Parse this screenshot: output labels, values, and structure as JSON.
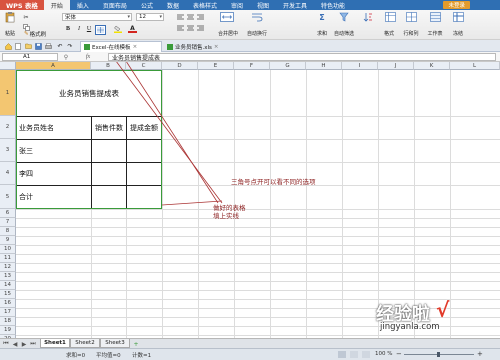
{
  "app": {
    "badge": "WPS 表格",
    "menu": [
      "开始",
      "插入",
      "页面布局",
      "公式",
      "数据",
      "表格样式",
      "审阅",
      "视图",
      "开发工具",
      "特色功能"
    ],
    "active_menu": "开始",
    "sign_in": "未登录"
  },
  "ribbon": {
    "paste": "粘贴",
    "cut": "✂",
    "format_painter": "格式刷",
    "font_name": "宋体",
    "font_size": "12",
    "bold": "B",
    "italic": "I",
    "underline": "U",
    "font_color_glyph": "A",
    "merge_center": "合并居中",
    "wrap": "自动换行",
    "sum": "求和",
    "filter": "自动筛选",
    "format": "格式",
    "row_col": "行和列",
    "sheet": "工作表",
    "freeze": "冻结"
  },
  "doc_tabs": [
    {
      "label": "Excel-在线模板",
      "active": true
    },
    {
      "label": "业务员销售.xls",
      "active": false
    }
  ],
  "formula_bar": {
    "cell_ref": "A1",
    "fx": "fx",
    "content": "业务员销售提成表"
  },
  "columns": [
    "A",
    "B",
    "C",
    "D",
    "E",
    "F",
    "G",
    "H",
    "I",
    "J",
    "K",
    "L"
  ],
  "rows": [
    "1",
    "2",
    "3",
    "4",
    "5",
    "6",
    "7",
    "8",
    "9",
    "10",
    "11",
    "12",
    "13",
    "14",
    "15",
    "16",
    "17",
    "18",
    "19",
    "20"
  ],
  "table": {
    "title": "业务员销售提成表",
    "headers": [
      "业务员姓名",
      "销售件数",
      "提成金额"
    ],
    "names": [
      "张三",
      "李四",
      "合计"
    ]
  },
  "annotations": {
    "triangle_note": "三角号点开可以看不同的选项",
    "table_note_1": "做好的表格",
    "table_note_2": "填上实线"
  },
  "sheets": [
    "Sheet1",
    "Sheet2",
    "Sheet3"
  ],
  "status": {
    "sum": "求和=0",
    "avg": "平均值=0",
    "count": "计数=1",
    "zoom": "100 %"
  },
  "watermark": {
    "text": "经验啦",
    "check": "√",
    "url": "jingyanla.com"
  },
  "colors": {
    "title_bar": "#2f6fb3",
    "app_badge": "#d8533f",
    "table_border": "#3a9b3a",
    "annotation": "#8b1d1d",
    "selected_header": "#f3c671"
  }
}
